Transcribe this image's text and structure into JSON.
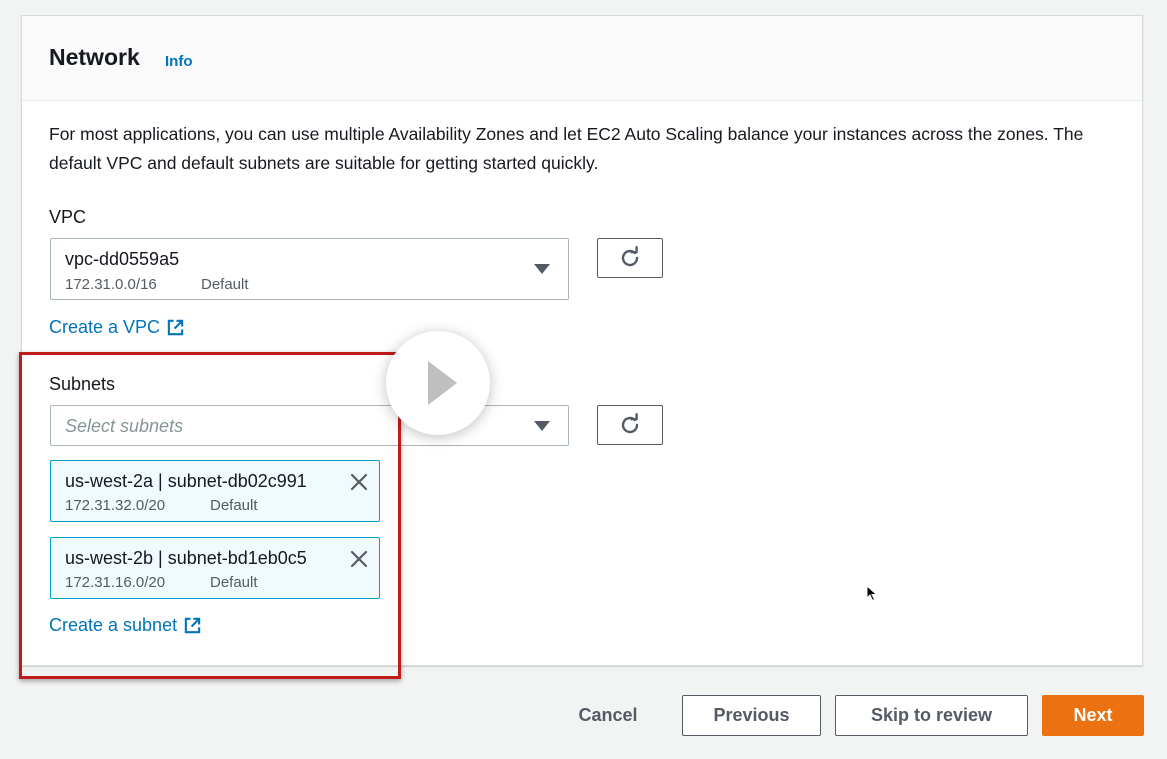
{
  "network": {
    "title": "Network",
    "info_label": "Info",
    "description": "For most applications, you can use multiple Availability Zones and let EC2 Auto Scaling balance your instances across the zones. The default VPC and default subnets are suitable for getting started quickly."
  },
  "vpc": {
    "label": "VPC",
    "selected_value": "vpc-dd0559a5",
    "cidr": "172.31.0.0/16",
    "tag": "Default",
    "create_link": "Create a VPC"
  },
  "subnets": {
    "label": "Subnets",
    "placeholder": "Select subnets",
    "selected": [
      {
        "title": "us-west-2a | subnet-db02c991",
        "cidr": "172.31.32.0/20",
        "tag": "Default"
      },
      {
        "title": "us-west-2b | subnet-bd1eb0c5",
        "cidr": "172.31.16.0/20",
        "tag": "Default"
      }
    ],
    "create_link": "Create a subnet"
  },
  "footer": {
    "cancel_label": "Cancel",
    "previous_label": "Previous",
    "skip_label": "Skip to review",
    "next_label": "Next"
  },
  "icons": {
    "refresh": "refresh-icon",
    "external": "external-link-icon",
    "dropdown": "caret-down-icon",
    "remove": "close-icon",
    "play": "play-icon"
  },
  "colors": {
    "link": "#0073bb",
    "primary": "#ec7211",
    "token_border": "#00a1c9",
    "highlight": "#c21b1b"
  }
}
